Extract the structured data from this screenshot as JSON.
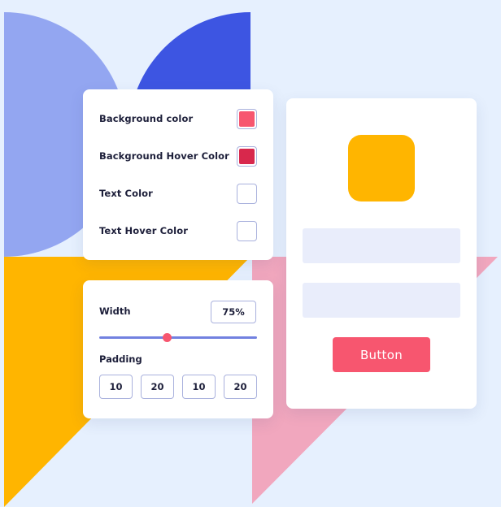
{
  "colors": {
    "background": "#e6f0fe",
    "light_blue_shape": "#93a6f1",
    "dark_blue_shape": "#3d55e2",
    "yellow_shape": "#ffb500",
    "pink_shape": "#f1a7be",
    "accent_pink": "#f7566f",
    "accent_crimson": "#d8284c",
    "slider": "#7281e0",
    "input_fill": "#e9edfb"
  },
  "color_settings": {
    "rows": [
      {
        "label": "Background color",
        "swatch": "#f7566f"
      },
      {
        "label": "Background Hover Color",
        "swatch": "#d8284c"
      },
      {
        "label": "Text Color",
        "swatch": null
      },
      {
        "label": "Text Hover Color",
        "swatch": null
      }
    ]
  },
  "size_settings": {
    "width_label": "Width",
    "width_value": "75%",
    "slider_level": 0.43,
    "padding_label": "Padding",
    "padding_values": [
      "10",
      "20",
      "10",
      "20"
    ]
  },
  "preview": {
    "square_color": "#ffb500",
    "button_label": "Button"
  }
}
